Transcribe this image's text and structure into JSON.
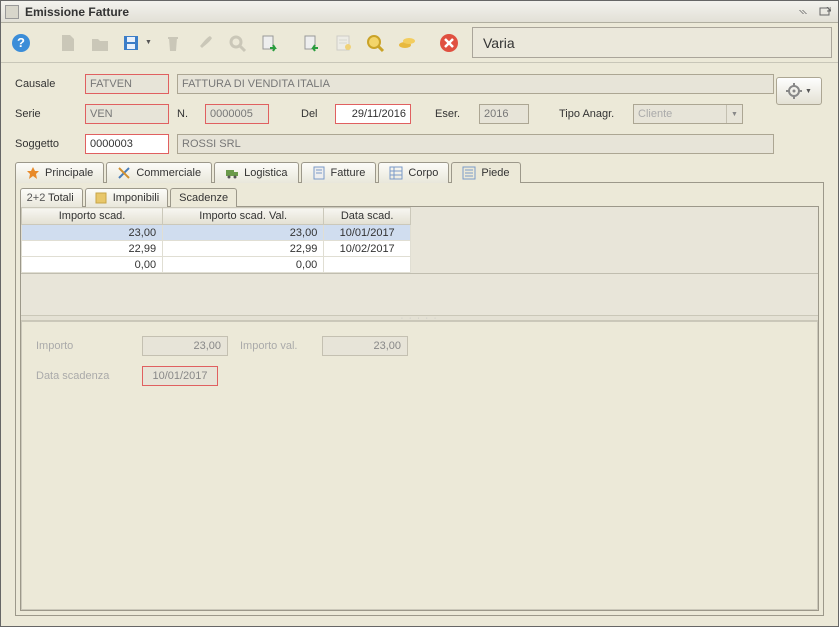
{
  "window": {
    "title": "Emissione Fatture"
  },
  "status": "Varia",
  "toolbarIcons": [
    "help",
    "new",
    "folder",
    "save",
    "trash",
    "brush",
    "search",
    "export",
    "import",
    "note",
    "zoom",
    "coins",
    "close"
  ],
  "form": {
    "causale_label": "Causale",
    "causale": "FATVEN",
    "causale_desc": "FATTURA DI VENDITA ITALIA",
    "serie_label": "Serie",
    "serie": "VEN",
    "n_label": "N.",
    "numero": "0000005",
    "del_label": "Del",
    "del": "29/11/2016",
    "eser_label": "Eser.",
    "eser": "2016",
    "tipoan_label": "Tipo Anagr.",
    "tipoan": "Cliente",
    "soggetto_label": "Soggetto",
    "soggetto": "0000003",
    "soggetto_desc": "ROSSI SRL"
  },
  "tabs": {
    "principale": "Principale",
    "commerciale": "Commerciale",
    "logistica": "Logistica",
    "fatture": "Fatture",
    "corpo": "Corpo",
    "piede": "Piede"
  },
  "subtabs": {
    "totali": "Totali",
    "imponibili": "Imponibili",
    "scadenze": "Scadenze",
    "totali_prefix": "2+2"
  },
  "grid": {
    "col_importo": "Importo scad.",
    "col_importo_val": "Importo scad. Val.",
    "col_data": "Data scad.",
    "rows": [
      {
        "importo": "23,00",
        "importo_val": "23,00",
        "data": "10/01/2017"
      },
      {
        "importo": "22,99",
        "importo_val": "22,99",
        "data": "10/02/2017"
      },
      {
        "importo": "0,00",
        "importo_val": "0,00",
        "data": ""
      }
    ]
  },
  "detail": {
    "importo_label": "Importo",
    "importo": "23,00",
    "importo_val_label": "Importo val.",
    "importo_val": "23,00",
    "data_label": "Data scadenza",
    "data": "10/01/2017"
  }
}
